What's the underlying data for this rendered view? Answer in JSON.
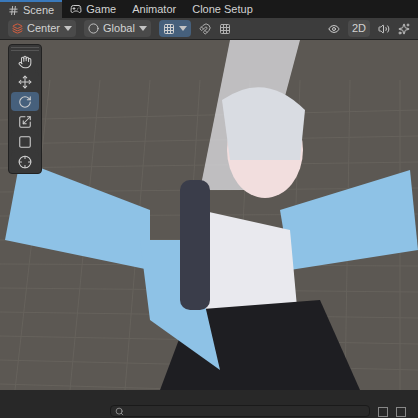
{
  "tabs": [
    {
      "label": "Scene",
      "selected": true,
      "kind": "scene"
    },
    {
      "label": "Game",
      "selected": false,
      "kind": "game"
    },
    {
      "label": "Animator",
      "selected": false,
      "kind": "plain"
    },
    {
      "label": "Clone Setup",
      "selected": false,
      "kind": "plain"
    }
  ],
  "toolbar": {
    "pivot": "Center",
    "space": "Global",
    "grid_snap": {
      "on": true
    },
    "mode_2d": {
      "label": "2D",
      "on": false
    }
  },
  "tools": [
    {
      "kind": "hand",
      "selected": false
    },
    {
      "kind": "move",
      "selected": false
    },
    {
      "kind": "rotate",
      "selected": true
    },
    {
      "kind": "scale",
      "selected": false
    },
    {
      "kind": "rect",
      "selected": false
    },
    {
      "kind": "transform",
      "selected": false
    }
  ]
}
